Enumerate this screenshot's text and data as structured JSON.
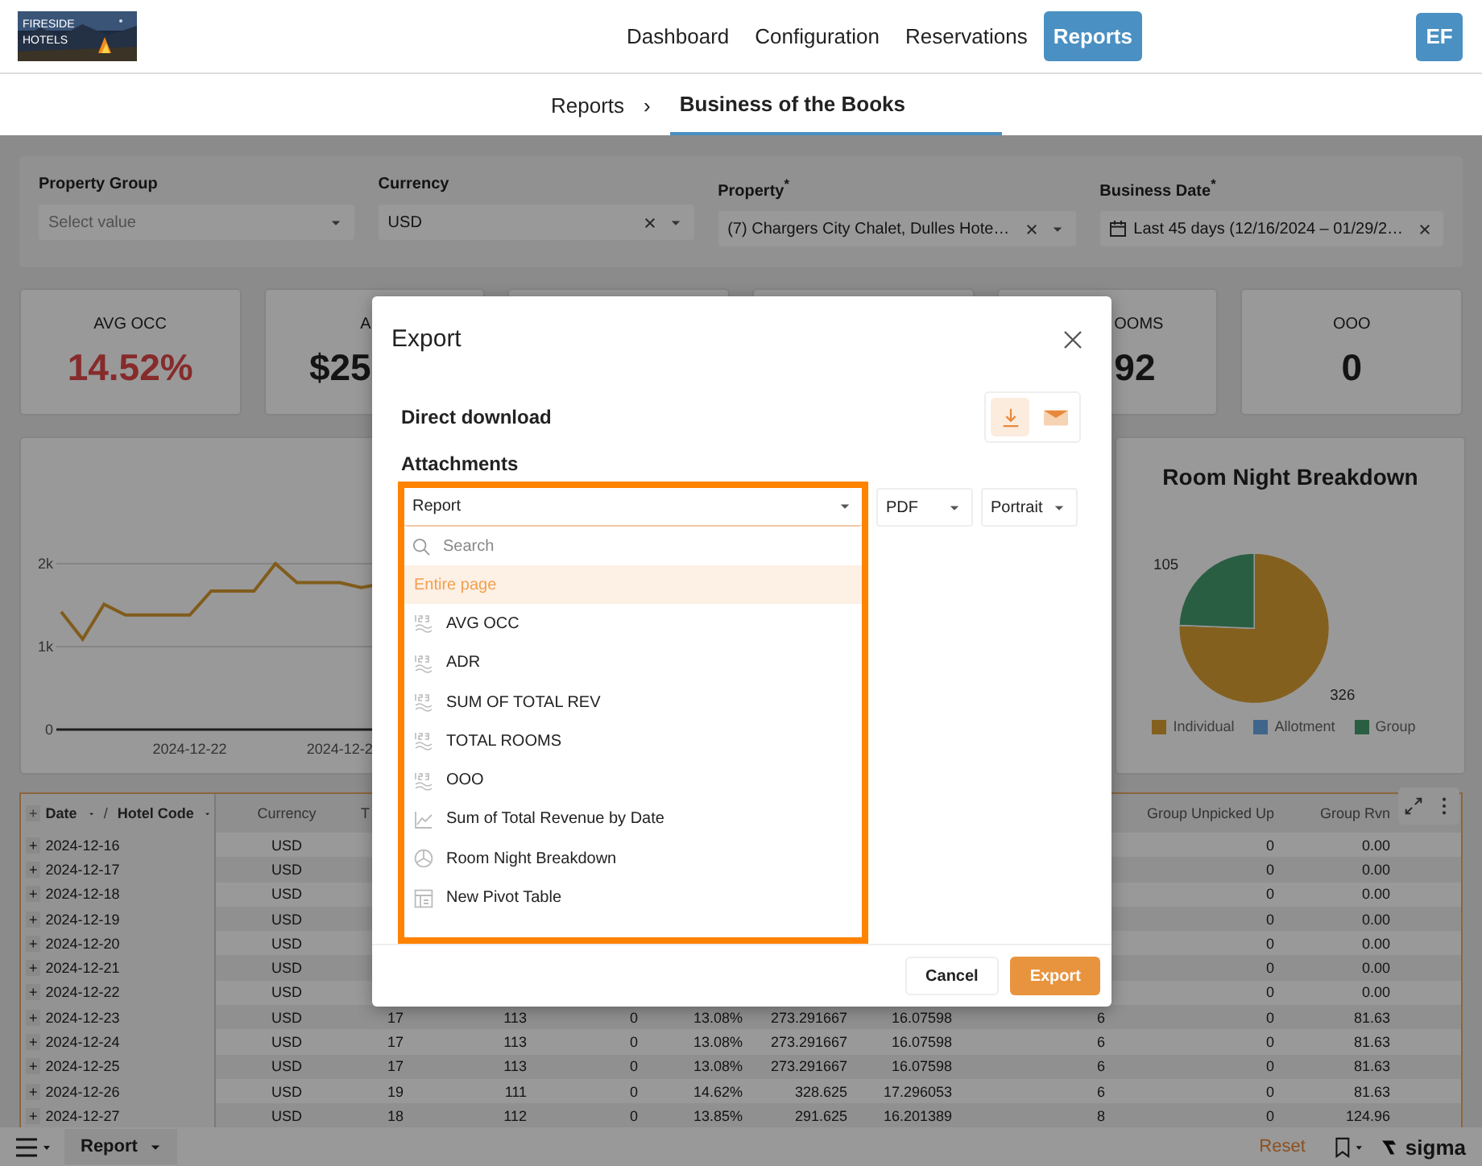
{
  "logo": {
    "text": "FIRESIDE HOTELS"
  },
  "nav": [
    {
      "label": "Dashboard",
      "selected": false
    },
    {
      "label": "Configuration",
      "selected": false
    },
    {
      "label": "Reservations",
      "selected": false
    },
    {
      "label": "Reports",
      "selected": true
    }
  ],
  "avatar": "EF",
  "breadcrumb": {
    "parent": "Reports",
    "separator": "›",
    "current": "Business of the Books"
  },
  "filters": [
    {
      "label": "Property Group",
      "placeholder": "Select value",
      "clearable": false
    },
    {
      "label": "Currency",
      "value": "USD",
      "clearable": true
    },
    {
      "label": "Property$^{*}$",
      "value": "(7) Chargers City Chalet, Dulles Hote…",
      "clearable": true
    },
    {
      "label": "Business Date$^{*}$",
      "value": "Last 45 days (12/16/2024 – 01/29/2…",
      "clearable": true,
      "calendar": true
    }
  ],
  "cards": [
    {
      "label": "AVG OCC",
      "value": "14.52%",
      "alert": true
    },
    {
      "label": "A",
      "value": "$25",
      "alert": false
    },
    {
      "label": "OOMS",
      "value": "92",
      "alert": false
    },
    {
      "label": "OOO",
      "value": "0",
      "alert": false
    }
  ],
  "line_panel": {
    "kind": "picture",
    "y_axis_labels": [
      "2k",
      "1k",
      "0"
    ],
    "x_axis_labels": [
      "2024-12-22",
      "2024-12-2"
    ]
  },
  "pie_panel": {
    "chart_data": {
      "type": "pie",
      "title": "Room Night Breakdown",
      "categories": [
        "Individual",
        "Allotment",
        "Group"
      ],
      "series": [
        {
          "values": [
            326,
            0,
            105
          ]
        }
      ],
      "colors": [
        "#dca035",
        "#6aa8e8",
        "#469d71"
      ],
      "data_labels": true
    }
  },
  "table": {
    "columns": {
      "toggle": "+",
      "date": "Date",
      "separator": "/",
      "hotel_code": "Hotel Code",
      "currency": "Currency",
      "column_3": "T",
      "group_unpicked_up": "Group Unpicked Up",
      "group_rvn": "Group Rvn"
    },
    "rows": [
      {
        "toggle": "+",
        "date": "2024-12-16",
        "currency": "USD",
        "group_unpicked_up": "0",
        "group_rvn": "0.00"
      },
      {
        "toggle": "+",
        "date": "2024-12-17",
        "currency": "USD",
        "group_unpicked_up": "0",
        "group_rvn": "0.00"
      },
      {
        "toggle": "+",
        "date": "2024-12-18",
        "currency": "USD",
        "group_unpicked_up": "0",
        "group_rvn": "0.00"
      },
      {
        "toggle": "+",
        "date": "2024-12-19",
        "currency": "USD",
        "group_unpicked_up": "0",
        "group_rvn": "0.00"
      },
      {
        "toggle": "+",
        "date": "2024-12-20",
        "currency": "USD",
        "group_unpicked_up": "0",
        "group_rvn": "0.00"
      },
      {
        "toggle": "+",
        "date": "2024-12-21",
        "currency": "USD",
        "group_unpicked_up": "0",
        "group_rvn": "0.00"
      },
      {
        "toggle": "+",
        "date": "2024-12-22",
        "currency": "USD",
        "group_unpicked_up": "0",
        "group_rvn": "0.00"
      },
      {
        "toggle": "+",
        "date": "2024-12-23",
        "currency": "USD",
        "values": [
          "17",
          "113",
          "0",
          "13.08%",
          "273.291667",
          "16.07598",
          "6"
        ],
        "group_unpicked_up": "0",
        "group_rvn": "81.63"
      },
      {
        "toggle": "+",
        "date": "2024-12-24",
        "currency": "USD",
        "values": [
          "17",
          "113",
          "0",
          "13.08%",
          "273.291667",
          "16.07598",
          "6"
        ],
        "group_unpicked_up": "0",
        "group_rvn": "81.63"
      },
      {
        "toggle": "+",
        "date": "2024-12-25",
        "currency": "USD",
        "values": [
          "17",
          "113",
          "0",
          "13.08%",
          "273.291667",
          "16.07598",
          "6"
        ],
        "group_unpicked_up": "0",
        "group_rvn": "81.63"
      },
      {
        "toggle": "+",
        "date": "2024-12-26",
        "currency": "USD",
        "values": [
          "19",
          "111",
          "0",
          "14.62%",
          "328.625",
          "17.296053",
          "6"
        ],
        "group_unpicked_up": "0",
        "group_rvn": "81.63"
      },
      {
        "toggle": "+",
        "date": "2024-12-27",
        "currency": "USD",
        "values": [
          "18",
          "112",
          "0",
          "13.85%",
          "291.625",
          "16.201389",
          "8"
        ],
        "group_unpicked_up": "0",
        "group_rvn": "124.96"
      }
    ]
  },
  "bottom_bar": {
    "tab": "Report",
    "reset": "Reset",
    "brand": "sigma"
  },
  "modal": {
    "title": "Export",
    "direct_download": "Direct download",
    "delivery": [
      {
        "kind": "download",
        "selected": true
      },
      {
        "kind": "email",
        "selected": false
      }
    ],
    "attachments": "Attachments",
    "attachment_select": "Report",
    "format": "PDF",
    "orientation": "Portrait",
    "search_placeholder": "Search",
    "options": [
      {
        "label": "Entire page",
        "kind": "page",
        "selected": true
      },
      {
        "label": "AVG OCC",
        "kind": "kpi",
        "selected": false
      },
      {
        "label": "ADR",
        "kind": "kpi",
        "selected": false
      },
      {
        "label": "SUM OF TOTAL REV",
        "kind": "kpi",
        "selected": false
      },
      {
        "label": "TOTAL ROOMS",
        "kind": "kpi",
        "selected": false
      },
      {
        "label": "OOO",
        "kind": "kpi",
        "selected": false
      },
      {
        "label": "Sum of Total Revenue by Date",
        "kind": "line",
        "selected": false
      },
      {
        "label": "Room Night Breakdown",
        "kind": "pie",
        "selected": false
      },
      {
        "label": "New Pivot Table",
        "kind": "pivot",
        "selected": false
      }
    ],
    "cancel": "Cancel",
    "export": "Export"
  }
}
